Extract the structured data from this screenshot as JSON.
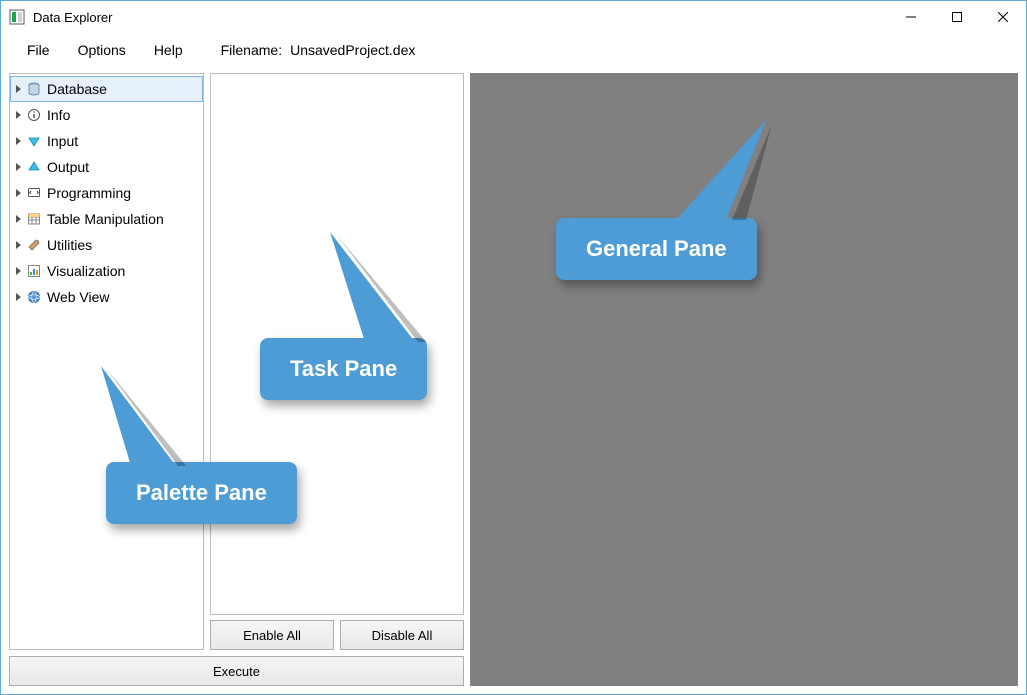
{
  "window": {
    "title": "Data Explorer"
  },
  "menubar": {
    "file": "File",
    "options": "Options",
    "help": "Help",
    "filename_label": "Filename:",
    "filename_value": "UnsavedProject.dex"
  },
  "palette": {
    "items": [
      {
        "label": "Database",
        "icon": "database-icon"
      },
      {
        "label": "Info",
        "icon": "info-icon"
      },
      {
        "label": "Input",
        "icon": "input-icon"
      },
      {
        "label": "Output",
        "icon": "output-icon"
      },
      {
        "label": "Programming",
        "icon": "programming-icon"
      },
      {
        "label": "Table Manipulation",
        "icon": "table-icon"
      },
      {
        "label": "Utilities",
        "icon": "utilities-icon"
      },
      {
        "label": "Visualization",
        "icon": "visualization-icon"
      },
      {
        "label": "Web View",
        "icon": "web-icon"
      }
    ]
  },
  "buttons": {
    "enable_all": "Enable All",
    "disable_all": "Disable All",
    "execute": "Execute"
  },
  "callouts": {
    "palette": "Palette Pane",
    "task": "Task Pane",
    "general": "General Pane"
  }
}
